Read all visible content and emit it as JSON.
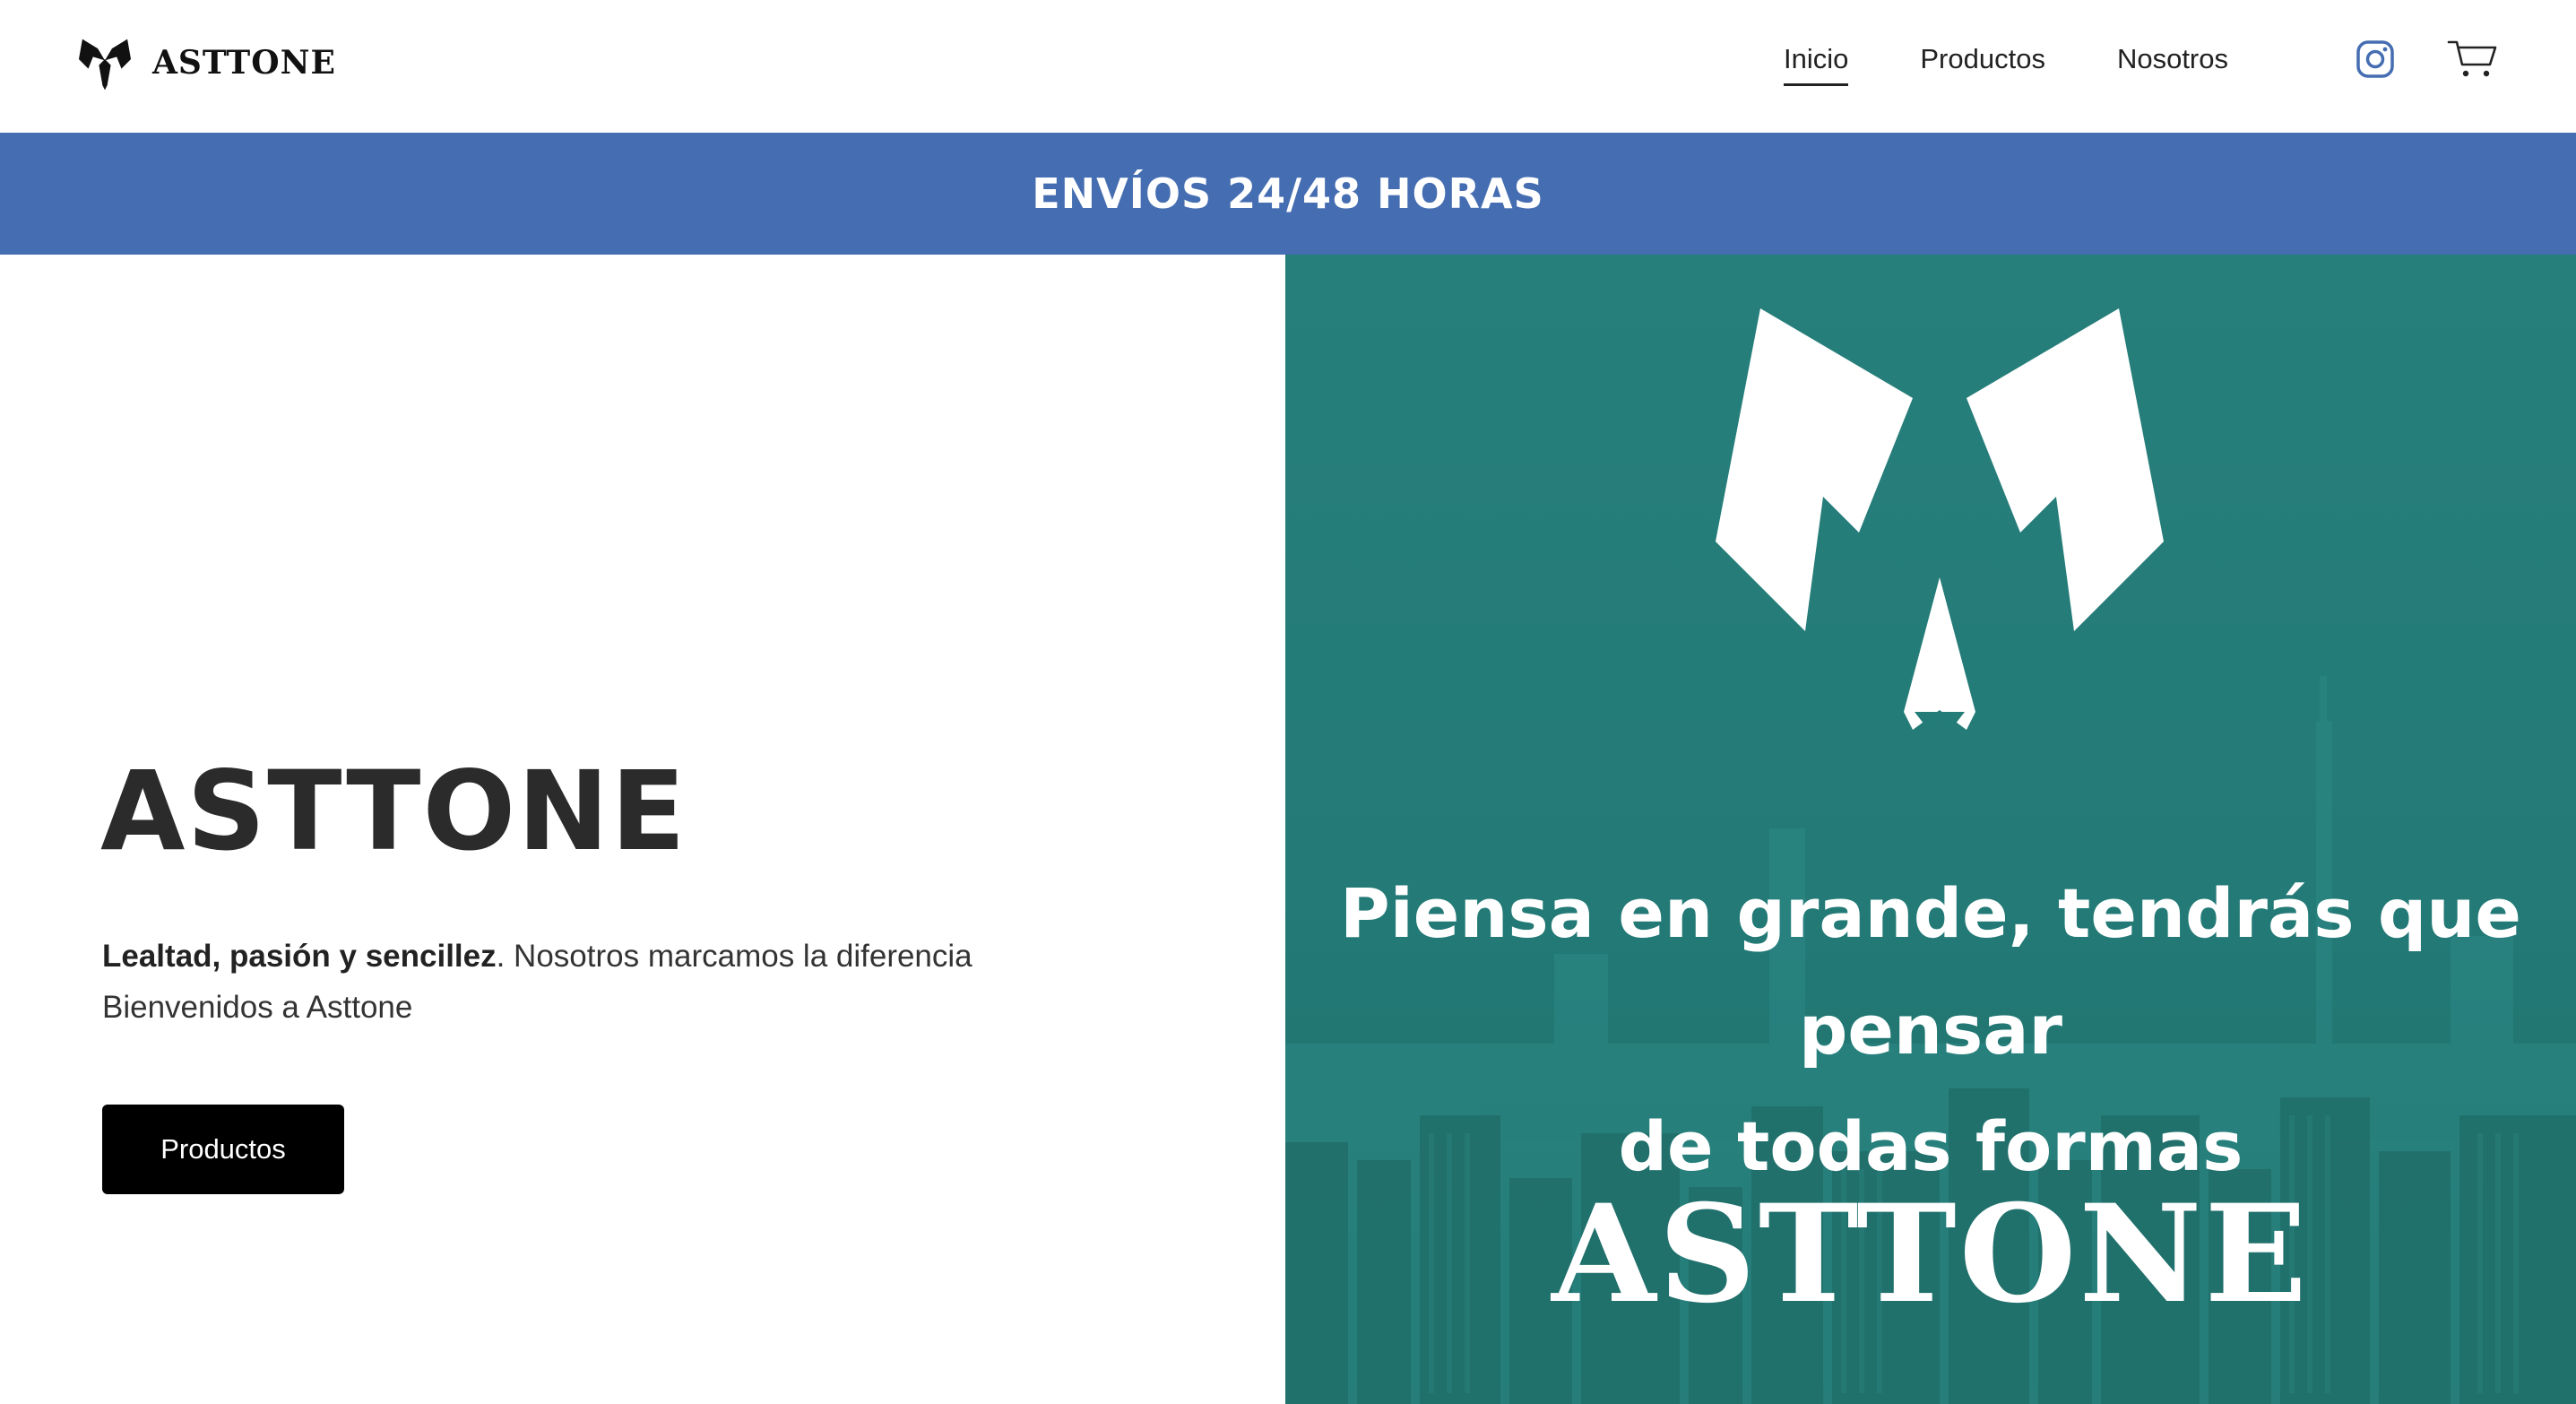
{
  "header": {
    "brand_name": "ASTTONE",
    "nav": [
      {
        "label": "Inicio",
        "active": true
      },
      {
        "label": "Productos",
        "active": false
      },
      {
        "label": "Nosotros",
        "active": false
      }
    ],
    "icons": {
      "social": "instagram-icon",
      "cart": "cart-icon"
    },
    "instagram_color": "#456db1"
  },
  "announcement": {
    "text": "ENVÍOS 24/48 HORAS",
    "background": "#456db1"
  },
  "hero": {
    "title": "ASTTONE",
    "desc_bold": "Lealtad, pasión y sencillez",
    "desc_rest": ". Nosotros marcamos la diferencia",
    "desc_line2": "Bienvenidos a Asttone",
    "button_label": "Productos",
    "button_color": "#000000"
  },
  "hero_image": {
    "slogan_line1": "Piensa en grande, tendrás que pensar",
    "slogan_line2": "de todas formas",
    "brand": "ASTTONE",
    "tint": "#237c78"
  }
}
